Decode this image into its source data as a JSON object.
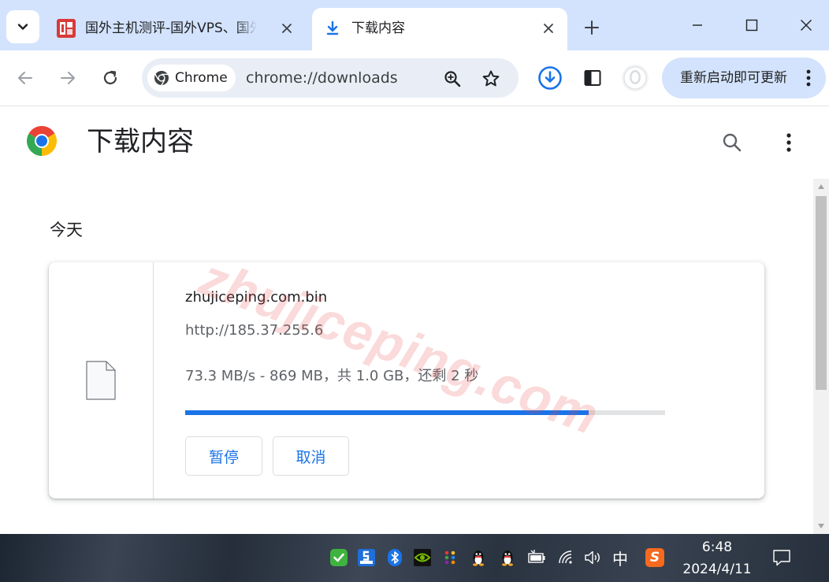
{
  "tabs": [
    {
      "title": "国外主机测评-国外VPS、国外",
      "active": false,
      "favicon": "zhujiceping-site-icon"
    },
    {
      "title": "下载内容",
      "active": true,
      "favicon": "download-arrow-icon"
    }
  ],
  "window_controls": [
    "minimize-icon",
    "maximize-icon",
    "close-icon"
  ],
  "toolbar": {
    "chip_label": "Chrome",
    "url": "chrome://downloads",
    "update_label": "重新启动即可更新",
    "icons": [
      "back-arrow-icon",
      "forward-arrow-icon",
      "reload-icon",
      "zoom-icon",
      "bookmark-star-icon",
      "downloads-icon",
      "side-panel-icon",
      "profile-avatar-icon",
      "more-menu-icon"
    ]
  },
  "page": {
    "title": "下载内容",
    "date_header": "今天"
  },
  "download": {
    "file_name": "zhujiceping.com.bin",
    "source_url": "http://185.37.255.6",
    "status": "73.3 MB/s - 869 MB，共 1.0 GB，还剩 2 秒",
    "progress_fraction": 0.84,
    "pause_label": "暂停",
    "cancel_label": "取消"
  },
  "watermark": "zhujiceping.com",
  "taskbar": {
    "ime_label": "中",
    "sogou_label": "S",
    "icons": [
      "wechat-icon",
      "360-security-icon",
      "bluetooth-icon",
      "nvidia-icon",
      "color-dots-icon",
      "qq-icon",
      "qq-icon",
      "battery-icon",
      "wifi-icon",
      "volume-icon",
      "ime-icon",
      "sogou-input-icon",
      "notification-icon"
    ],
    "time": "6:48",
    "date": "2024/4/11"
  },
  "colors": {
    "tabstrip": "#d3e3fd",
    "accent": "#1a73e8",
    "update_pill": "#d3e3fd",
    "watermark": "#e84646"
  }
}
